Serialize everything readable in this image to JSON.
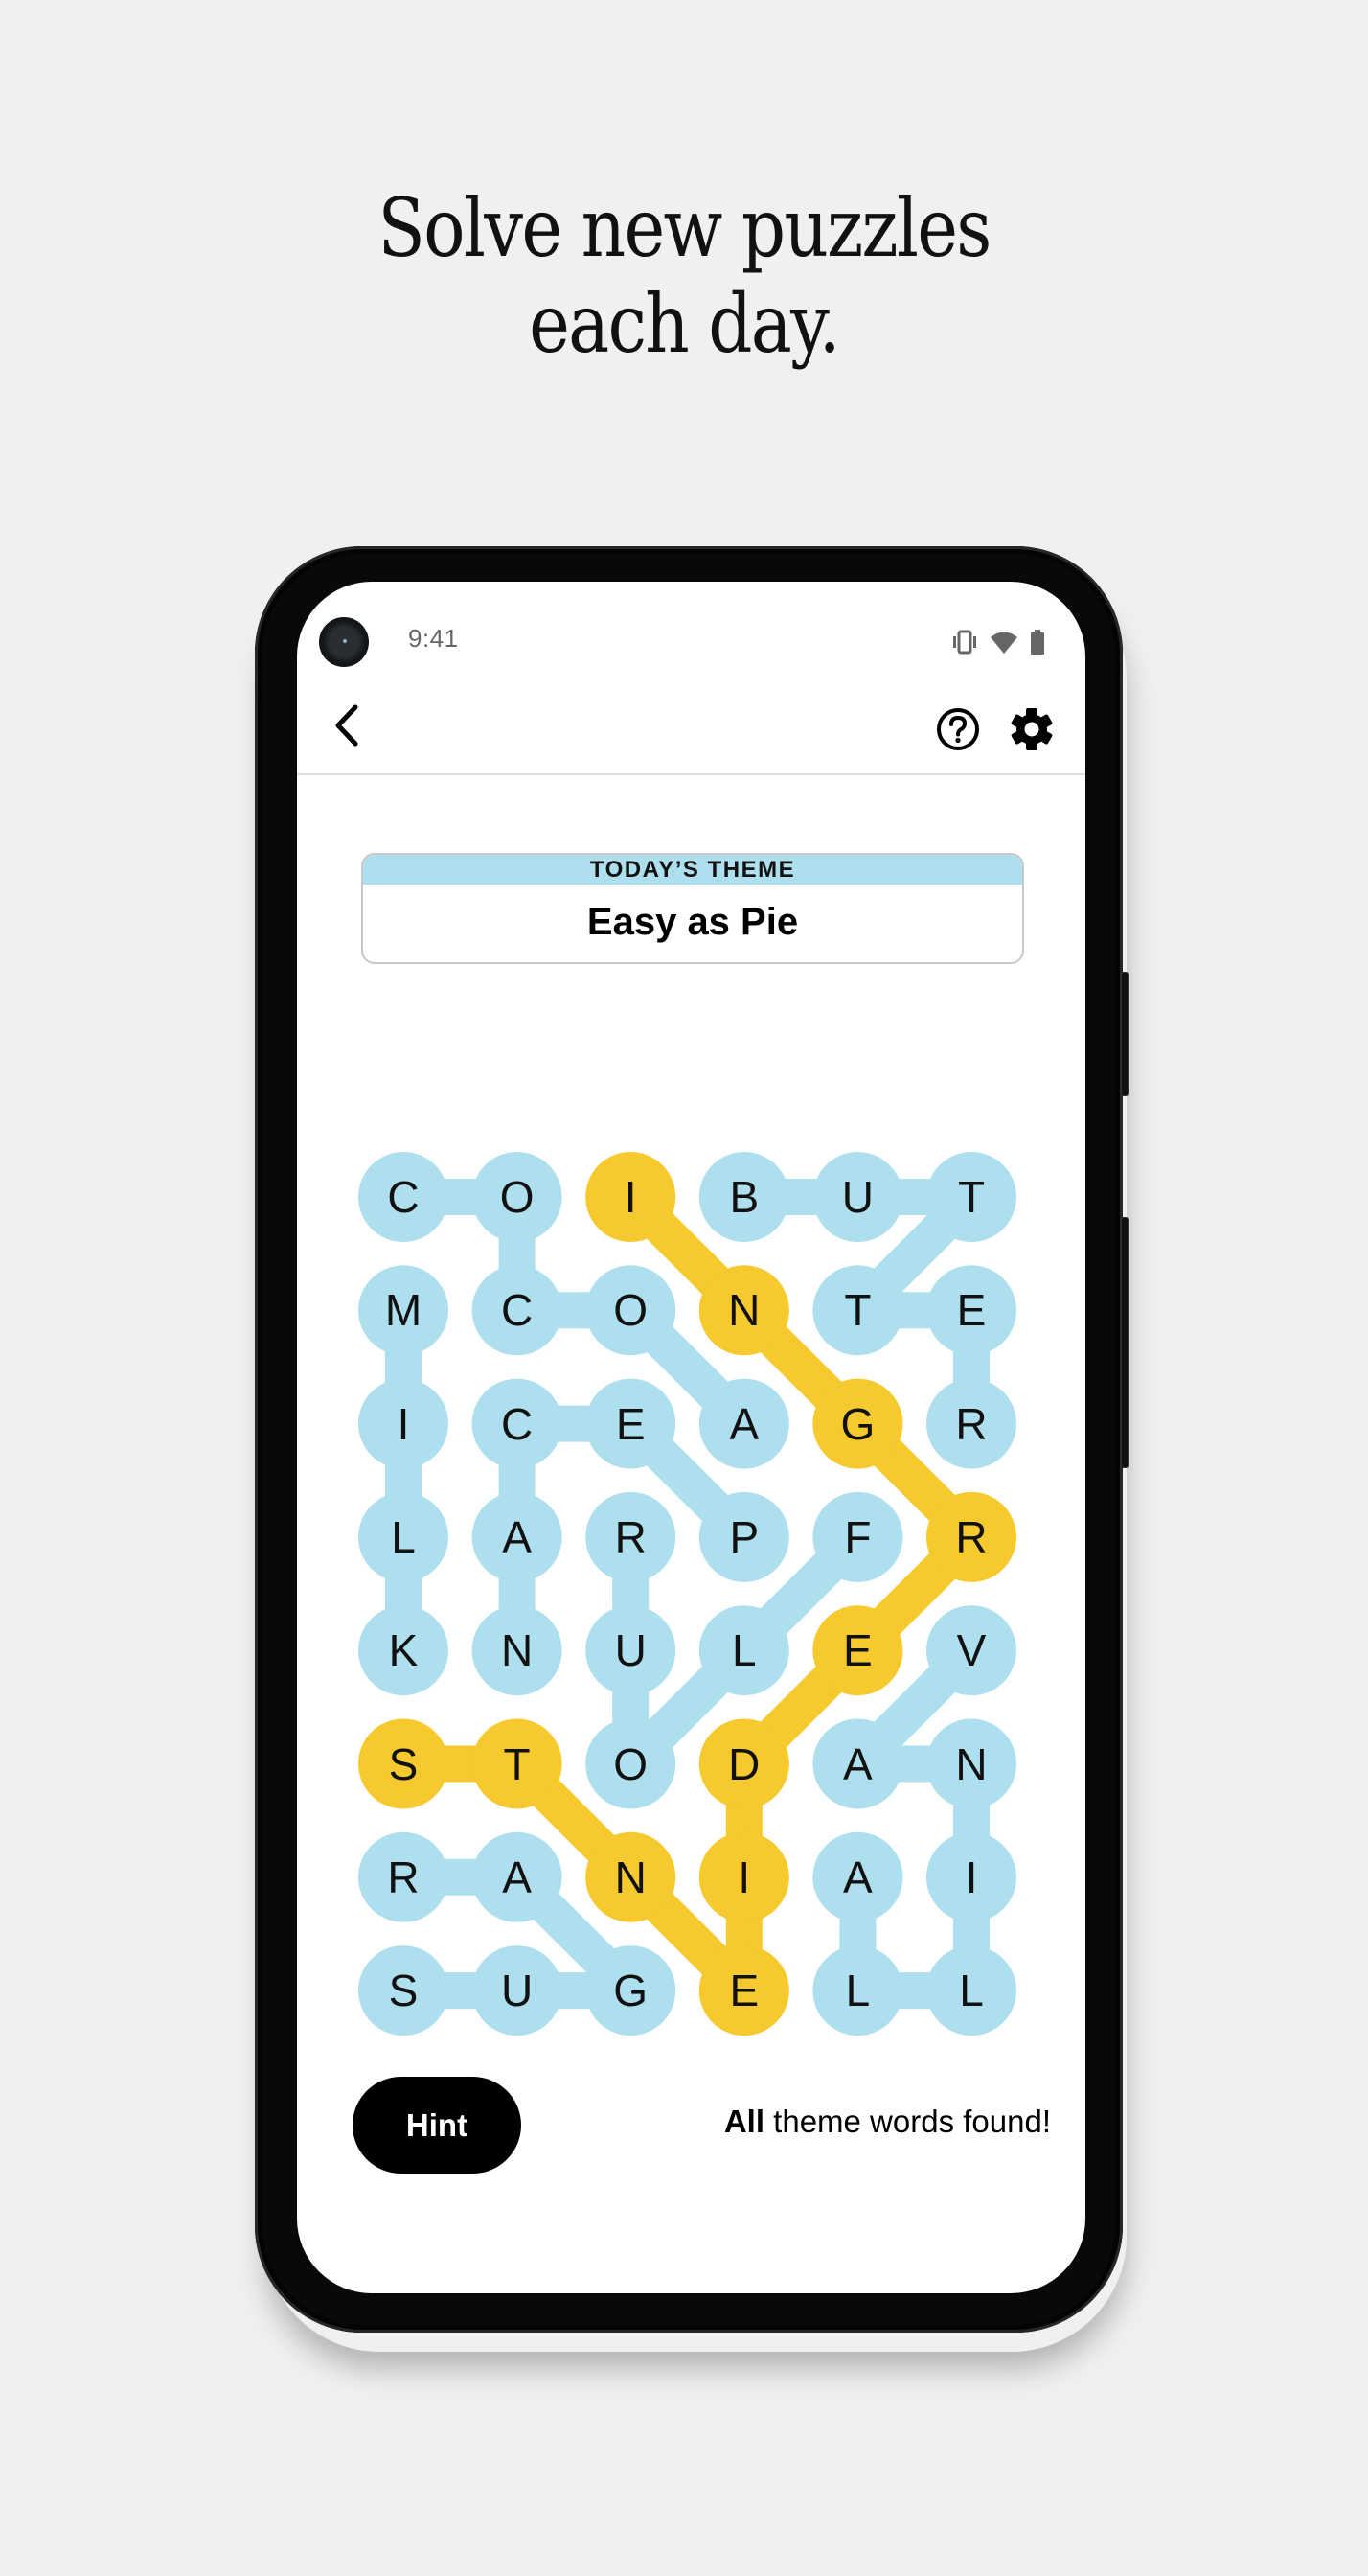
{
  "headline": {
    "line1": "Solve new puzzles",
    "line2": "each day."
  },
  "status_bar": {
    "time": "9:41",
    "icons": [
      "vibrate-icon",
      "wifi-icon",
      "battery-icon"
    ]
  },
  "header": {
    "back_icon": "chevron-left-icon",
    "help_icon": "help-circle-icon",
    "settings_icon": "gear-icon"
  },
  "theme": {
    "label": "TODAY’S THEME",
    "title": "Easy as Pie"
  },
  "colors": {
    "found_word": "#aedfee",
    "spangram": "#f6c92f",
    "text": "#111111"
  },
  "grid": {
    "rows": [
      [
        "C",
        "O",
        "I",
        "B",
        "U",
        "T"
      ],
      [
        "M",
        "C",
        "O",
        "N",
        "T",
        "E"
      ],
      [
        "I",
        "C",
        "E",
        "A",
        "G",
        "R"
      ],
      [
        "L",
        "A",
        "R",
        "P",
        "F",
        "R"
      ],
      [
        "K",
        "N",
        "U",
        "L",
        "E",
        "V"
      ],
      [
        "S",
        "T",
        "O",
        "D",
        "A",
        "N"
      ],
      [
        "R",
        "A",
        "N",
        "I",
        "A",
        "I"
      ],
      [
        "S",
        "U",
        "G",
        "E",
        "L",
        "L"
      ]
    ],
    "words": [
      {
        "word": "COCOA",
        "type": "theme",
        "path": [
          [
            0,
            0
          ],
          [
            0,
            1
          ],
          [
            1,
            1
          ],
          [
            1,
            2
          ],
          [
            2,
            3
          ]
        ]
      },
      {
        "word": "BUTTER",
        "type": "theme",
        "path": [
          [
            0,
            3
          ],
          [
            0,
            4
          ],
          [
            0,
            5
          ],
          [
            1,
            4
          ],
          [
            1,
            5
          ],
          [
            2,
            5
          ]
        ]
      },
      {
        "word": "MILK",
        "type": "theme",
        "path": [
          [
            1,
            0
          ],
          [
            2,
            0
          ],
          [
            3,
            0
          ],
          [
            4,
            0
          ]
        ]
      },
      {
        "word": "PECAN",
        "type": "theme",
        "path": [
          [
            3,
            3
          ],
          [
            2,
            2
          ],
          [
            2,
            1
          ],
          [
            3,
            1
          ],
          [
            4,
            1
          ]
        ]
      },
      {
        "word": "FLOUR",
        "type": "theme",
        "path": [
          [
            3,
            4
          ],
          [
            4,
            3
          ],
          [
            5,
            2
          ],
          [
            4,
            2
          ],
          [
            3,
            2
          ]
        ]
      },
      {
        "word": "VANILLA",
        "type": "theme",
        "path": [
          [
            4,
            5
          ],
          [
            5,
            4
          ],
          [
            5,
            5
          ],
          [
            6,
            5
          ],
          [
            7,
            5
          ],
          [
            7,
            4
          ],
          [
            6,
            4
          ]
        ]
      },
      {
        "word": "SUGAR",
        "type": "theme",
        "path": [
          [
            7,
            0
          ],
          [
            7,
            1
          ],
          [
            7,
            2
          ],
          [
            6,
            1
          ],
          [
            6,
            0
          ]
        ]
      },
      {
        "word": "INGREDIENTS",
        "type": "spangram",
        "path": [
          [
            0,
            2
          ],
          [
            1,
            3
          ],
          [
            2,
            4
          ],
          [
            3,
            5
          ],
          [
            4,
            4
          ],
          [
            5,
            3
          ],
          [
            6,
            3
          ],
          [
            7,
            3
          ],
          [
            6,
            2
          ],
          [
            5,
            1
          ],
          [
            5,
            0
          ]
        ]
      }
    ]
  },
  "footer": {
    "hint_label": "Hint",
    "status_bold": "All",
    "status_rest": " theme words found!"
  }
}
